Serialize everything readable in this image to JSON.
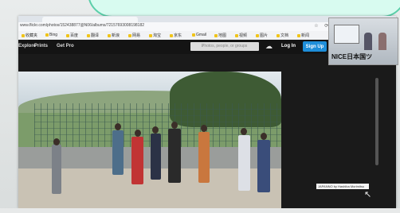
{
  "browser": {
    "url": "www.flickr.com/photos/152438877@N06/albums/72157693008198182",
    "bookmarks": [
      "收藏夹",
      "Bing",
      "百度",
      "翻译",
      "新浪",
      "网易",
      "淘宝",
      "京东",
      "Gmail",
      "地图",
      "视频",
      "图片",
      "文档",
      "新闻",
      "音乐"
    ]
  },
  "site_nav": {
    "explore": "Explore",
    "prints": "Prints",
    "get_pro": "Get Pro",
    "search_placeholder": "Photos, people, or groups",
    "login": "Log In",
    "signup": "Sign Up"
  },
  "photo": {
    "caption": "JAPANNO by Hashiba Morimitsu"
  },
  "webcam": {
    "label": "NICE日本国ツ"
  }
}
